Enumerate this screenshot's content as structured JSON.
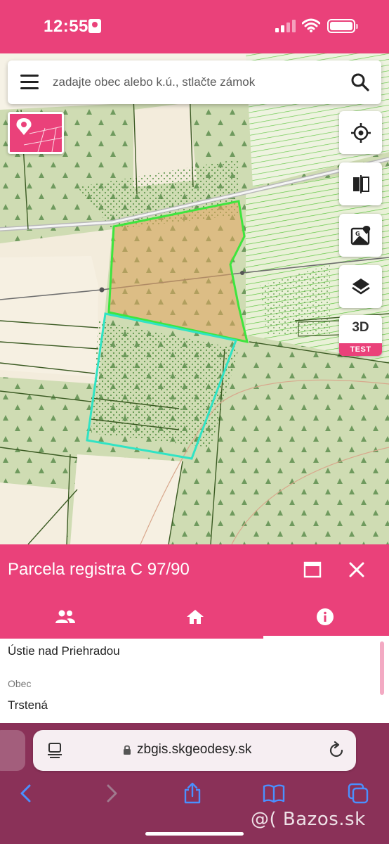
{
  "status_bar": {
    "time": "12:55"
  },
  "map": {
    "search": {
      "placeholder": "zadajte obec alebo k.ú., stlačte zámok"
    },
    "controls": {
      "three_d_label": "3D",
      "test_badge": "TEST"
    }
  },
  "panel": {
    "title": "Parcela registra C 97/90",
    "tabs": [
      {
        "icon": "people-icon"
      },
      {
        "icon": "home-icon"
      },
      {
        "icon": "info-icon",
        "active": true
      }
    ],
    "fields": [
      {
        "value": "Ústie nad Priehradou"
      },
      {
        "label": "Obec",
        "value": "Trstená"
      }
    ]
  },
  "browser": {
    "url": "zbgis.skgeodesy.sk"
  },
  "watermark": "@( Bazos.sk",
  "colors": {
    "accent": "#ea417a",
    "browser_chrome": "#8a3158",
    "parcel_green": "#3ee53e",
    "parcel_cyan": "#30e3c4"
  }
}
